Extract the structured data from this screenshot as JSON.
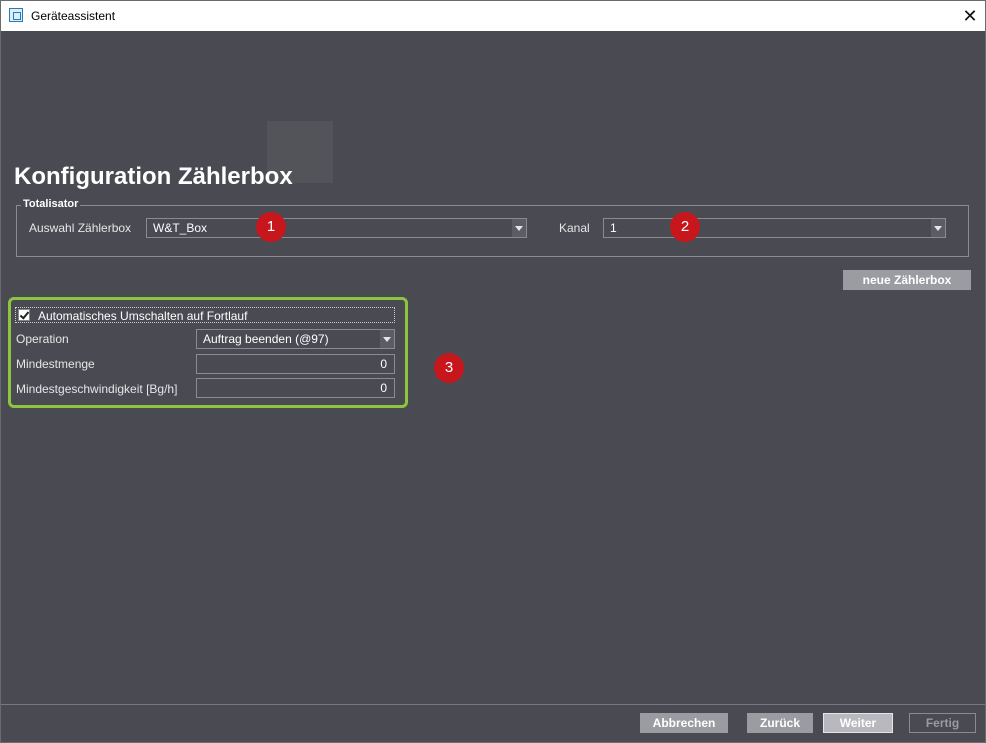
{
  "window": {
    "title": "Geräteassistent",
    "close_glyph": "✕"
  },
  "page": {
    "heading": "Konfiguration Zählerbox"
  },
  "totalisator": {
    "legend": "Totalisator",
    "auswahl_label": "Auswahl Zählerbox",
    "auswahl_value": "W&T_Box",
    "kanal_label": "Kanal",
    "kanal_value": "1"
  },
  "badges": [
    "1",
    "2",
    "3"
  ],
  "new_box_button": "neue Zählerbox",
  "fortlauf": {
    "checkbox_label": "Automatisches Umschalten auf Fortlauf",
    "checked": true,
    "operation_label": "Operation",
    "operation_value": "Auftrag beenden (@97)",
    "mindestmenge_label": "Mindestmenge",
    "mindestmenge_value": "0",
    "mindestgeschw_label": "Mindestgeschwindigkeit [Bg/h]",
    "mindestgeschw_value": "0"
  },
  "footer": {
    "cancel": "Abbrechen",
    "back": "Zurück",
    "next": "Weiter",
    "finish": "Fertig"
  },
  "colors": {
    "background": "#4a4a53",
    "highlight": "#8cc63f",
    "badge": "#c7161c"
  }
}
